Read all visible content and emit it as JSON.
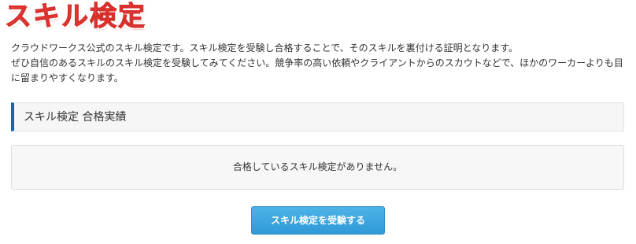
{
  "page": {
    "title": "スキル検定",
    "description_lines": [
      "クラウドワークス公式のスキル検定です。スキル検定を受験し合格することで、そのスキルを裏付ける証明となります。",
      "ぜひ自信のあるスキルのスキル検定を受験してみてください。競争率の高い依頼やクライアントからのスカウトなどで、ほかのワーカーよりも目",
      "に留まりやすくなります。"
    ]
  },
  "section": {
    "heading": "スキル検定 合格実績",
    "empty_message": "合格しているスキル検定がありません。"
  },
  "actions": {
    "take_exam_label": "スキル検定を受験する"
  },
  "colors": {
    "title_red": "#f0403c",
    "section_accent": "#1565b4",
    "button_blue": "#2f9ad8"
  }
}
